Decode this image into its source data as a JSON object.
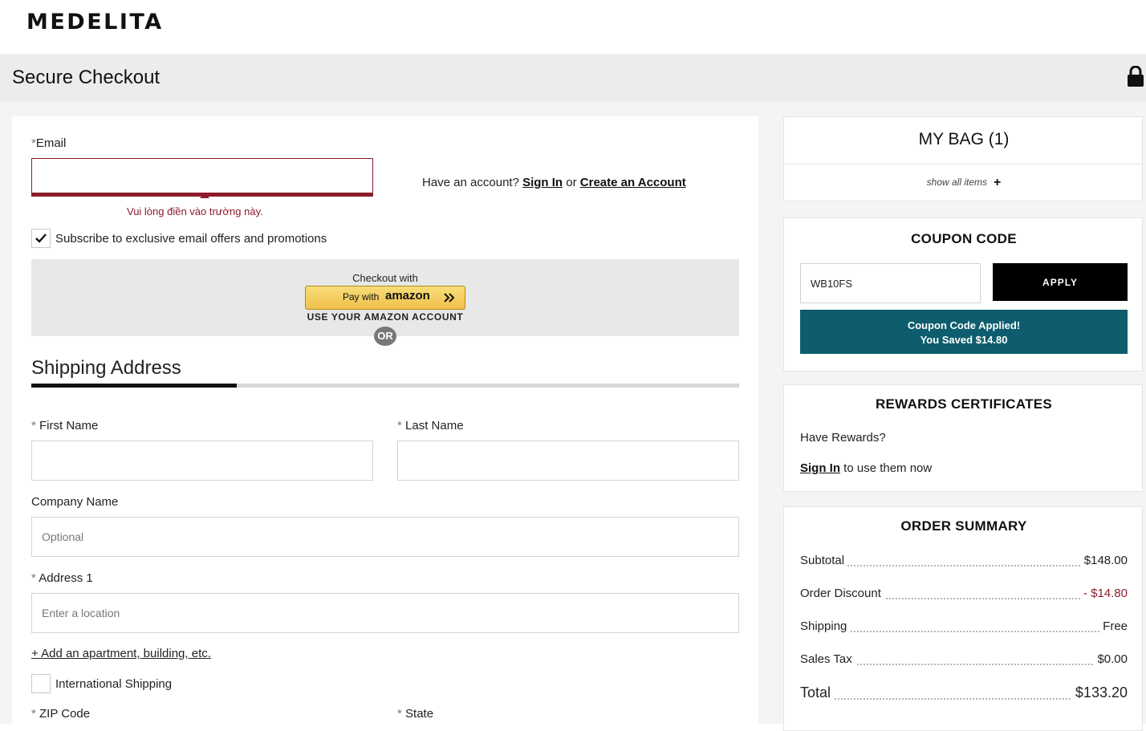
{
  "header": {
    "logo": "MEDELITA",
    "checkout_title": "Secure Checkout",
    "lock_icon": "lock-icon"
  },
  "email": {
    "label_star": "*",
    "label": "Email",
    "value": "",
    "validation_message": "Vui lòng điền vào trường này.",
    "error_color": "#8c1c2c"
  },
  "account": {
    "prompt": "Have an account?",
    "sign_in": "Sign In",
    "or": "or",
    "create": "Create an Account"
  },
  "subscribe": {
    "checked": true,
    "label": "Subscribe to exclusive email offers and promotions"
  },
  "amazon": {
    "caption": "Checkout with",
    "pay_with": "Pay with",
    "brand": "amazon",
    "use_account": "USE YOUR AMAZON ACCOUNT",
    "or": "OR"
  },
  "shipping": {
    "title": "Shipping Address",
    "progress": 0.29,
    "first_name": {
      "label": "First Name",
      "value": ""
    },
    "last_name": {
      "label": "Last Name",
      "value": ""
    },
    "company": {
      "label": "Company Name",
      "placeholder": "Optional"
    },
    "address1": {
      "label": "Address 1",
      "placeholder": "Enter a location"
    },
    "add_apartment": "+ Add an apartment, building, etc.",
    "international": {
      "label": "International Shipping",
      "checked": false
    },
    "zip": {
      "label": "ZIP Code"
    },
    "state": {
      "label": "State"
    },
    "required_star": "*"
  },
  "bag": {
    "title": "MY BAG (1)",
    "show_all": "show all items",
    "plus_icon": "+"
  },
  "coupon": {
    "title": "COUPON CODE",
    "value": "WB10FS",
    "apply": "APPLY",
    "applied_line1": "Coupon Code Applied!",
    "applied_line2": "You Saved $14.80",
    "applied_color": "#0d5d6e"
  },
  "rewards": {
    "title": "REWARDS CERTIFICATES",
    "question": "Have Rewards?",
    "sign_in": "Sign In",
    "suffix": "to use them now"
  },
  "summary": {
    "title": "ORDER SUMMARY",
    "rows": [
      {
        "label": "Subtotal",
        "value": "$148.00"
      },
      {
        "label": "Order Discount",
        "value": "- $14.80"
      },
      {
        "label": "Shipping",
        "value": "Free"
      },
      {
        "label": "Sales Tax",
        "value": "$0.00"
      }
    ],
    "total": {
      "label": "Total",
      "value": "$133.20"
    }
  }
}
